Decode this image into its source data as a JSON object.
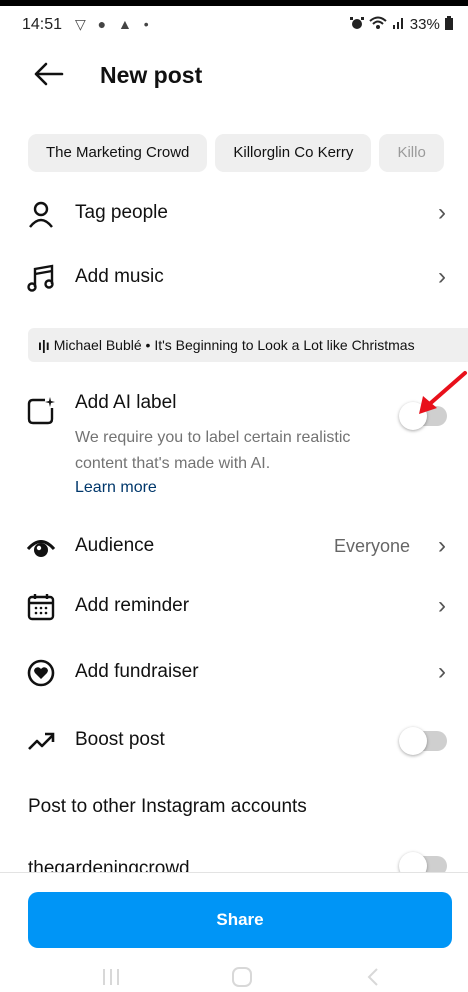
{
  "status_bar": {
    "time": "14:51",
    "left_icons": "▽ ● ▲ •",
    "battery": "33%"
  },
  "header": {
    "title": "New post"
  },
  "chips": [
    "The Marketing Crowd",
    "Killorglin Co Kerry",
    "Killo"
  ],
  "tag_people": {
    "label": "Tag people"
  },
  "add_music": {
    "label": "Add music"
  },
  "music_track": {
    "text": "Michael Bublé • It's Beginning to Look a Lot like Christmas"
  },
  "ai_label": {
    "label": "Add AI label",
    "description": "We require you to label certain realistic content that's made with AI.",
    "learn_more": "Learn more",
    "enabled": false
  },
  "audience": {
    "label": "Audience",
    "value": "Everyone"
  },
  "add_reminder": {
    "label": "Add reminder"
  },
  "add_fundraiser": {
    "label": "Add fundraiser"
  },
  "boost_post": {
    "label": "Boost post",
    "enabled": false
  },
  "other_accounts": {
    "title": "Post to other Instagram accounts",
    "accounts": [
      {
        "name": "thegardeningcrowd",
        "enabled": false
      }
    ]
  },
  "share_button": {
    "label": "Share"
  },
  "colors": {
    "accent": "#0095f6",
    "link": "#00376b",
    "annotation_arrow": "#e8101b"
  }
}
